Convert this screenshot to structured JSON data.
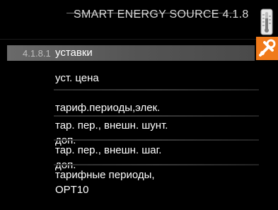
{
  "header": {
    "title": "SMART ENERGY SOURCE 4.1.8",
    "icon": "thermometer-icon"
  },
  "selected": {
    "number": "4.1.8.1",
    "label": "уставки",
    "side_icon": "wrench-icon"
  },
  "items": [
    {
      "label": "уст. цена"
    },
    {
      "label": "тариф.периоды,элек."
    },
    {
      "label_line1": "тар. пер., внешн. шунт.",
      "label_line2": "доп."
    },
    {
      "label_line1": "тар. пер., внешн. шаг.",
      "label_line2": "доп."
    },
    {
      "label_line1": "тарифные периоды,",
      "label_line2": "OPT10"
    }
  ],
  "colors": {
    "background": "#000000",
    "accent_orange": "#f07a1a",
    "selected_bar": "#5e5e5e"
  }
}
